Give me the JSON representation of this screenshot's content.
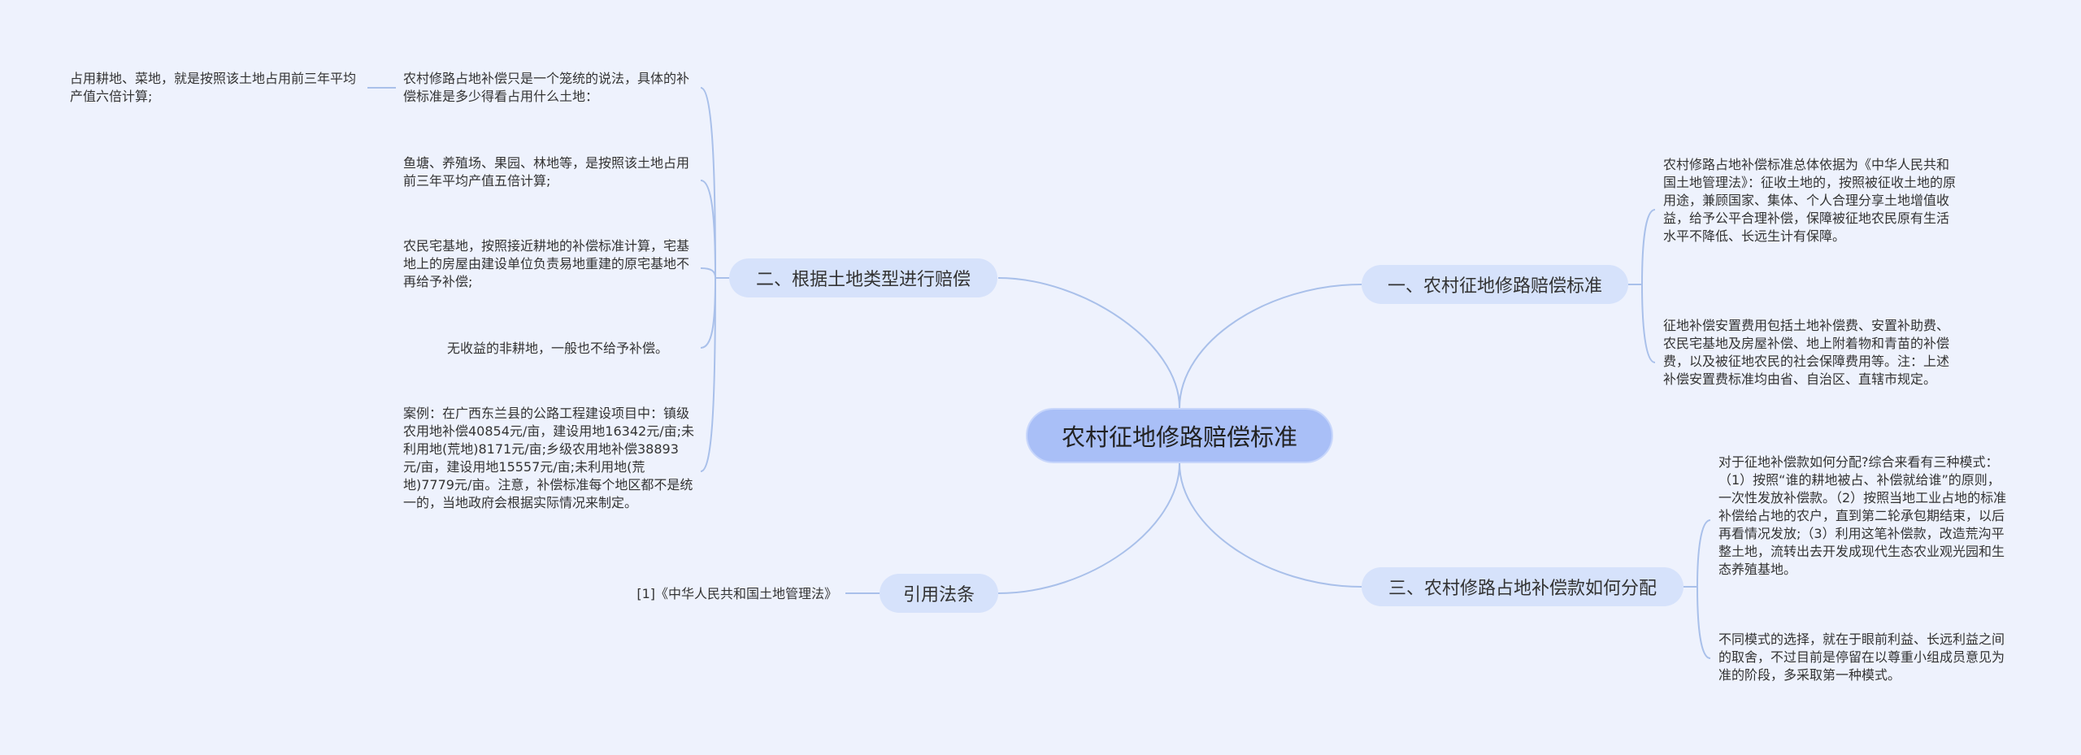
{
  "root": {
    "label": "农村征地修路赔偿标准"
  },
  "branch1": {
    "label": "一、农村征地修路赔偿标准",
    "leaves": [
      "农村修路占地补偿标准总体依据为《中华人民共和国土地管理法》：征收土地的，按照被征收土地的原用途，兼顾国家、集体、个人合理分享土地增值收益，给予公平合理补偿，保障被征地农民原有生活水平不降低、长远生计有保障。",
      "征地补偿安置费用包括土地补偿费、安置补助费、农民宅基地及房屋补偿、地上附着物和青苗的补偿费，以及被征地农民的社会保障费用等。注：上述补偿安置费标准均由省、自治区、直辖市规定。"
    ]
  },
  "branch2": {
    "label": "二、根据土地类型进行赔偿",
    "leaves": [
      "农村修路占地补偿只是一个笼统的说法，具体的补偿标准是多少得看占用什么土地：",
      "鱼塘、养殖场、果园、林地等，是按照该土地占用前三年平均产值五倍计算;",
      "农民宅基地，按照接近耕地的补偿标准计算，宅基地上的房屋由建设单位负责易地重建的原宅基地不再给予补偿;",
      "无收益的非耕地，一般也不给予补偿。",
      "案例：在广西东兰县的公路工程建设项目中：镇级农用地补偿40854元/亩，建设用地16342元/亩;未利用地(荒地)8171元/亩;乡级农用地补偿38893元/亩，建设用地15557元/亩;未利用地(荒地)7779元/亩。注意，补偿标准每个地区都不是统一的，当地政府会根据实际情况来制定。"
    ],
    "subleaf": "占用耕地、菜地，就是按照该土地占用前三年平均产值六倍计算;"
  },
  "branch3": {
    "label": "三、农村修路占地补偿款如何分配",
    "leaves": [
      "对于征地补偿款如何分配?综合来看有三种模式：（1）按照“谁的耕地被占、补偿就给谁”的原则，一次性发放补偿款。（2）按照当地工业占地的标准补偿给占地的农户，直到第二轮承包期结束，以后再看情况发放;（3）利用这笔补偿款，改造荒沟平整土地，流转出去开发成现代生态农业观光园和生态养殖基地。",
      "不同模式的选择，就在于眼前利益、长远利益之间的取舍，不过目前是停留在以尊重小组成员意见为准的阶段，多采取第一种模式。"
    ]
  },
  "branch4": {
    "label": "引用法条",
    "leaves": [
      "[1]《中华人民共和国土地管理法》"
    ]
  }
}
